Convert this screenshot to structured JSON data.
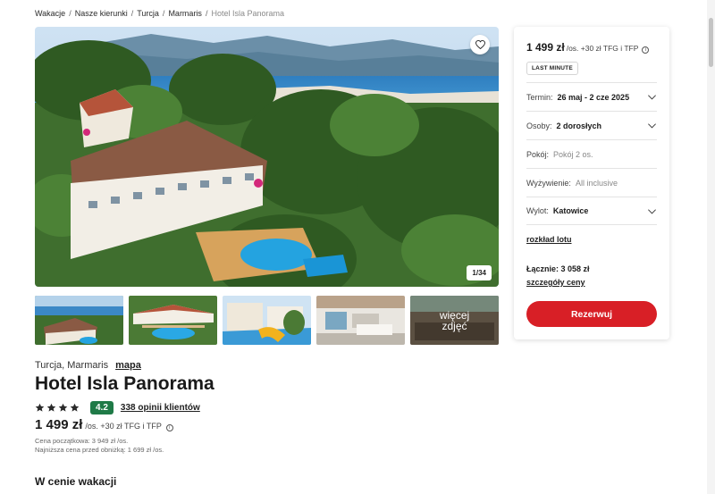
{
  "breadcrumb": {
    "items": [
      "Wakacje",
      "Nasze kierunki",
      "Turcja",
      "Marmaris",
      "Hotel Isla Panorama"
    ],
    "separator": "/"
  },
  "gallery": {
    "counter": "1/34",
    "more_label": "więcej zdjęć",
    "favorite_icon": "heart-icon"
  },
  "hotel": {
    "location": "Turcja, Marmaris",
    "map_link": "mapa",
    "name": "Hotel Isla Panorama",
    "stars": 4,
    "score": "4.2",
    "reviews_link": "338 opinii klientów",
    "price": "1 499 zł",
    "price_suffix": "/os. +30 zł TFG i TFP",
    "start_price": "Cena początkowa: 3 949 zł /os.",
    "lowest_price": "Najniższa cena przed obniżką: 1 699 zł /os.",
    "section_title": "W cenie wakacji"
  },
  "booking": {
    "price": "1 499 zł",
    "price_suffix": "/os. +30 zł TFG i TFP",
    "badge": "LAST MINUTE",
    "term_label": "Termin:",
    "term_value": "26 maj - 2 cze 2025",
    "persons_label": "Osoby:",
    "persons_value": "2 dorosłych",
    "room_label": "Pokój:",
    "room_value": "Pokój 2 os.",
    "board_label": "Wyżywienie:",
    "board_value": "All inclusive",
    "departure_label": "Wylot:",
    "departure_value": "Katowice",
    "flight_link": "rozkład lotu",
    "total": "Łącznie: 3 058 zł",
    "details_link": "szczegóły ceny",
    "book_button": "Rezerwuj"
  },
  "colors": {
    "accent": "#d81f26",
    "score_badge": "#1f7a47"
  }
}
